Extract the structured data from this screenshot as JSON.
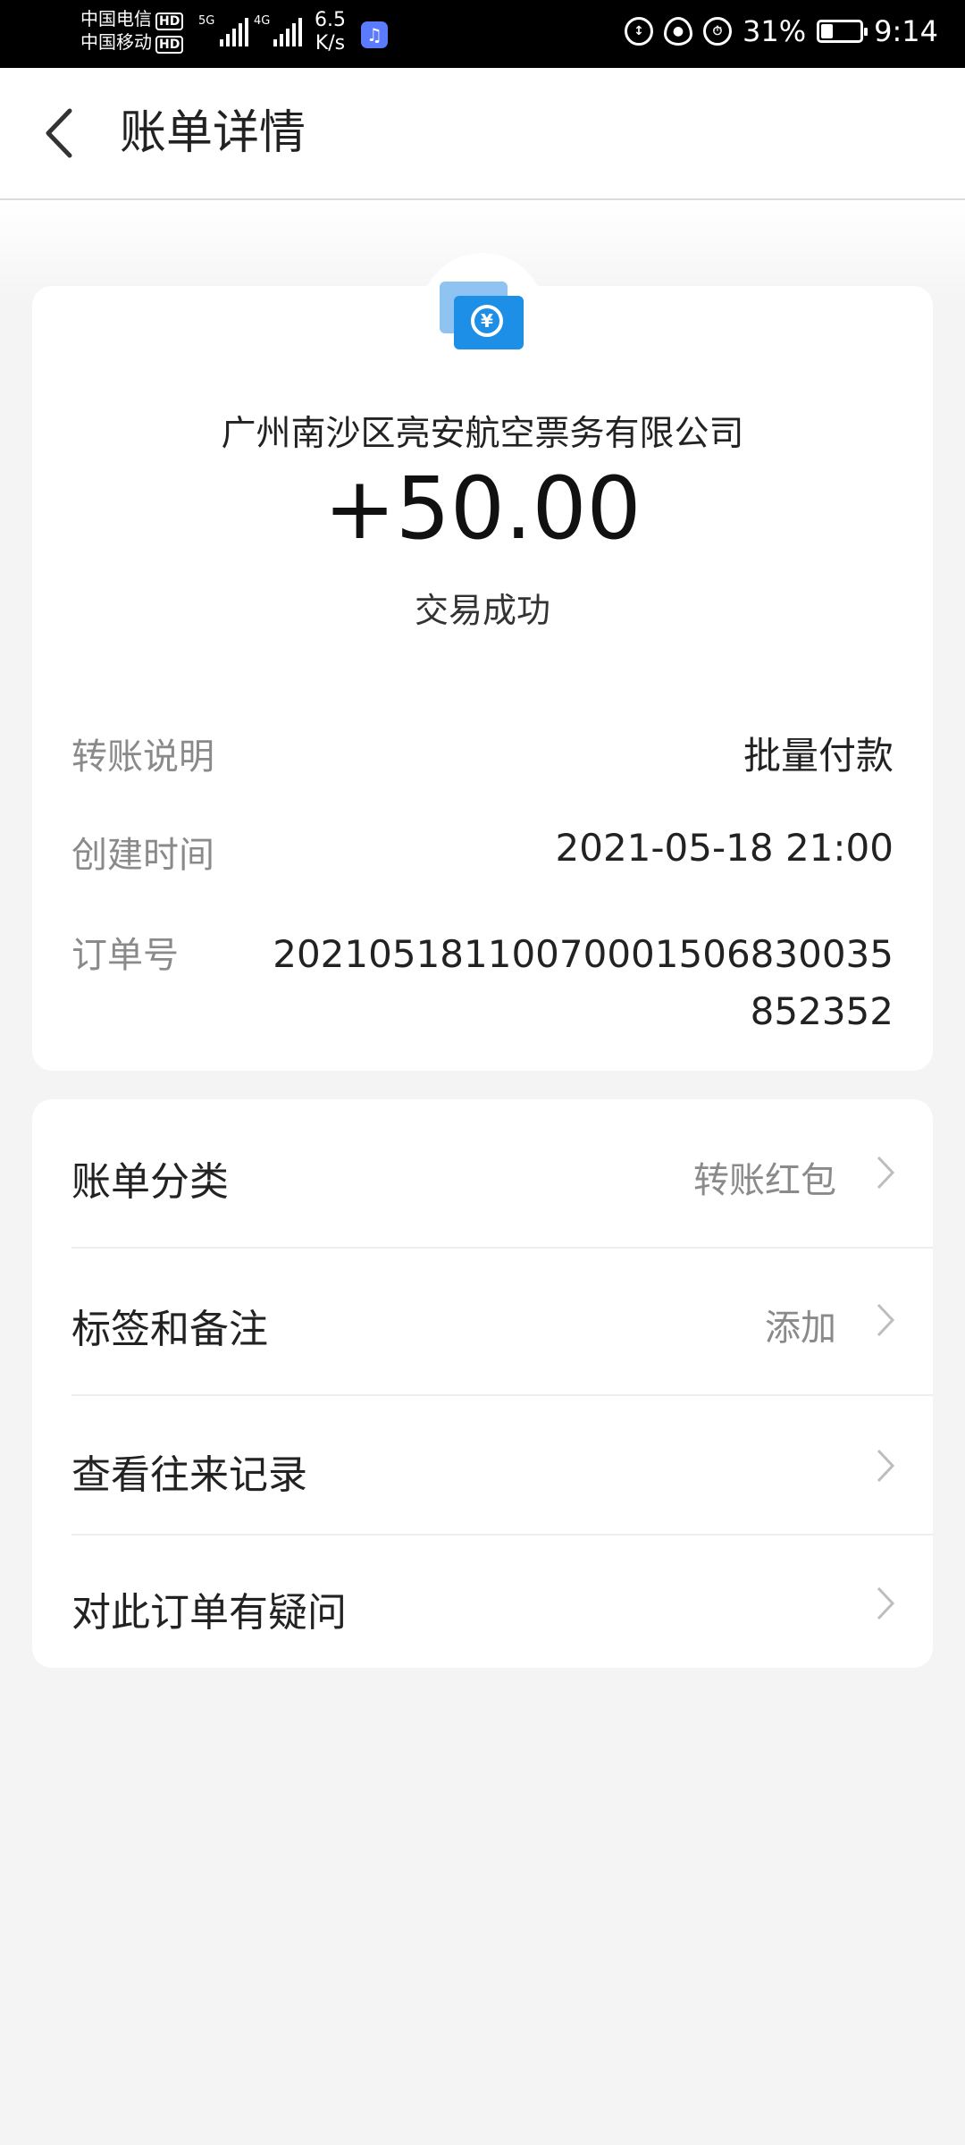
{
  "status_bar": {
    "carrier1": "中国电信",
    "carrier2": "中国移动",
    "hd_badge": "HD",
    "net1": "5G",
    "net2": "4G",
    "speed_value": "6.5",
    "speed_unit": "K/s",
    "battery_percent": "31%",
    "battery_level": 0.31,
    "time": "9:14"
  },
  "header": {
    "title": "账单详情"
  },
  "transaction": {
    "merchant": "广州南沙区亮安航空票务有限公司",
    "amount": "+50.00",
    "status": "交易成功",
    "icon": "transfer-yuan-icon",
    "icon_colors": {
      "front": "#1e8fe6",
      "back": "#8fc4f2"
    }
  },
  "details": {
    "note_label": "转账说明",
    "note_value": "批量付款",
    "created_label": "创建时间",
    "created_value": "2021-05-18 21:00",
    "order_label": "订单号",
    "order_value": "20210518110070001506830035852352"
  },
  "menu": [
    {
      "label": "账单分类",
      "value": "转账红包"
    },
    {
      "label": "标签和备注",
      "value": "添加"
    },
    {
      "label": "查看往来记录",
      "value": ""
    },
    {
      "label": "对此订单有疑问",
      "value": ""
    }
  ]
}
